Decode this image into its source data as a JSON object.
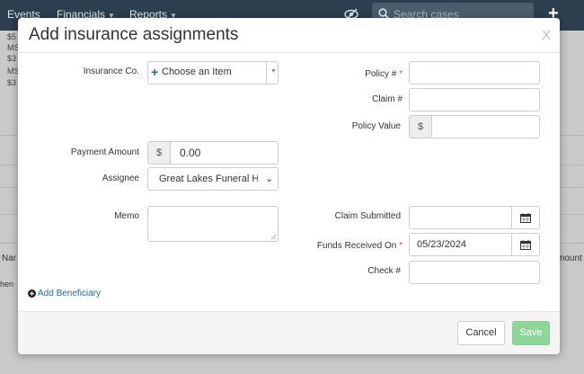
{
  "topbar": {
    "nav": [
      "Events",
      "Financials",
      "Reports"
    ],
    "search_placeholder": "Search cases",
    "add_label": "+"
  },
  "background": {
    "snippets": [
      "$5",
      "MS",
      "$3",
      "MS",
      "$3"
    ],
    "col_left": "Nar",
    "col_right": "mount",
    "row_text": "hen"
  },
  "modal": {
    "title": "Add insurance assignments",
    "close": "X",
    "insurance_label": "Insurance Co.",
    "insurance_plus": "+",
    "insurance_value": "Choose an Item",
    "policy_label": "Policy #",
    "required_mark": "*",
    "claim_label": "Claim #",
    "policy_value_label": "Policy Value",
    "currency": "$",
    "payment_label": "Payment Amount",
    "payment_value": "0.00",
    "assignee_label": "Assignee",
    "assignee_value": "Great Lakes Funeral Home",
    "memo_label": "Memo",
    "claim_submitted_label": "Claim Submitted",
    "funds_received_label": "Funds Received On",
    "funds_received_value": "05/23/2024",
    "check_label": "Check #",
    "add_beneficiary": "Add Beneficiary",
    "cancel": "Cancel",
    "save": "Save"
  },
  "colors": {
    "topbar": "#2d3e4e",
    "link": "#1a6fa8",
    "save": "#8fd49b",
    "required": "#d9534f"
  }
}
